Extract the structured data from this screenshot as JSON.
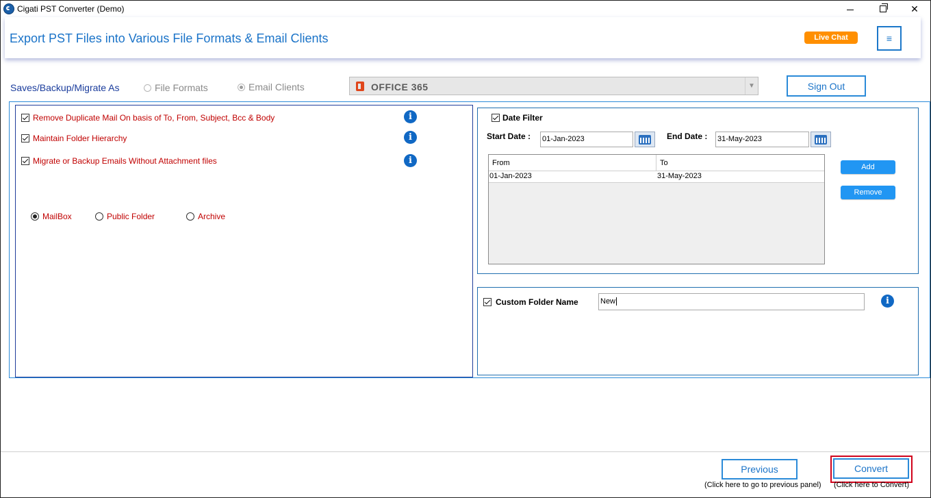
{
  "window": {
    "title": "Cigati PST Converter (Demo)",
    "minimize_glyph": "minimize",
    "maximize_glyph": "restore",
    "close_glyph": "✕"
  },
  "header": {
    "title": "Export PST Files into Various File Formats & Email Clients",
    "live_chat": "Live Chat",
    "menu_glyph": "≡"
  },
  "saves": {
    "label": "Saves/Backup/Migrate As",
    "options": [
      {
        "label": "File Formats",
        "selected": false
      },
      {
        "label": "Email Clients",
        "selected": true
      }
    ],
    "destination": "OFFICE 365",
    "sign_out": "Sign Out"
  },
  "options": {
    "items": [
      {
        "label": "Remove Duplicate Mail On basis of To, From, Subject, Bcc & Body",
        "checked": true
      },
      {
        "label": "Maintain Folder Hierarchy",
        "checked": true
      },
      {
        "label": "Migrate or Backup Emails Without Attachment files",
        "checked": true
      }
    ],
    "info_glyph": "i",
    "mailbox_types": [
      {
        "label": "MailBox",
        "selected": true
      },
      {
        "label": "Public Folder",
        "selected": false
      },
      {
        "label": "Archive",
        "selected": false
      }
    ]
  },
  "date_filter": {
    "label": "Date Filter",
    "checked": true,
    "start_label": "Start Date :",
    "start_value": "01-Jan-2023",
    "end_label": "End Date :",
    "end_value": "31-May-2023",
    "columns": [
      "From",
      "To"
    ],
    "rows": [
      {
        "from": "01-Jan-2023",
        "to": "31-May-2023"
      }
    ],
    "add_label": "Add",
    "remove_label": "Remove"
  },
  "custom_folder": {
    "label": "Custom Folder Name",
    "checked": true,
    "value": "New"
  },
  "footer": {
    "previous_label": "Previous",
    "previous_hint": "(Click here to go to previous panel)",
    "convert_label": "Convert",
    "convert_hint": "(Click here to Convert)"
  },
  "colors": {
    "accent": "#1a73c8",
    "live_chat": "#ff8f00",
    "option_text": "#c00000",
    "highlight": "#d0021b"
  }
}
